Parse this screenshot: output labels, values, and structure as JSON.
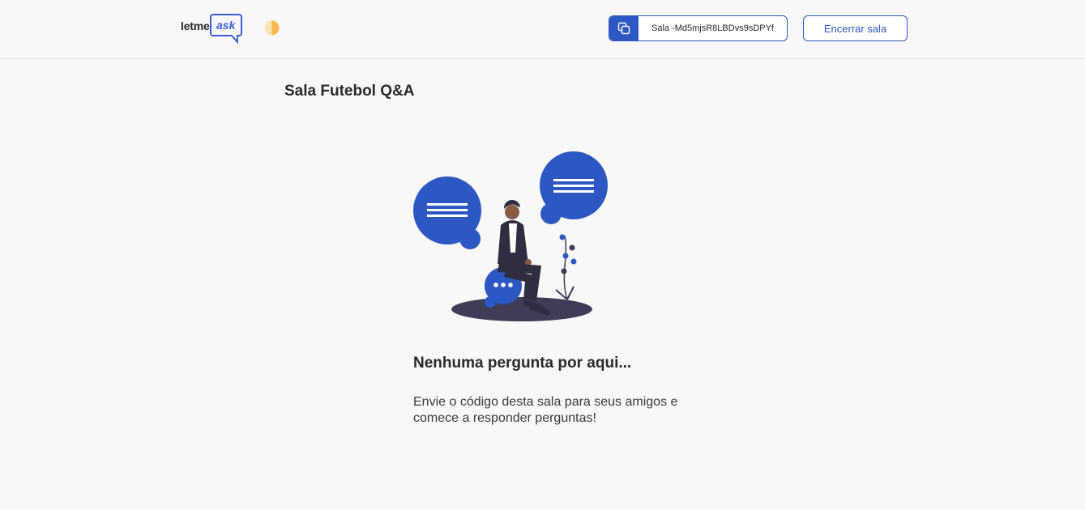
{
  "header": {
    "logo": {
      "part1": "letme",
      "part2": "ask"
    },
    "room_code": {
      "label": "Sala -Md5mjsR8LBDvs9sDPYf",
      "icon": "copy-icon"
    },
    "end_room_label": "Encerrar sala",
    "theme_toggle_icon": "half-circle-icon"
  },
  "main": {
    "room_title": "Sala Futebol Q&A",
    "empty_state": {
      "title": "Nenhuma pergunta por aqui...",
      "description": "Envie o código desta sala para seus amigos e comece a responder perguntas!"
    }
  },
  "colors": {
    "accent": "#2d58c4",
    "text": "#29292e",
    "background": "#f8f8f8",
    "toggle": "#f6b94e"
  }
}
